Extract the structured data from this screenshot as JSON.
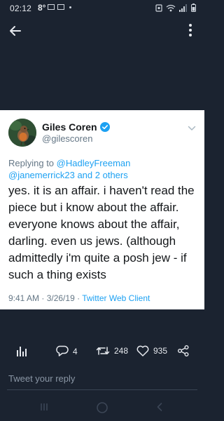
{
  "status_bar": {
    "time": "02:12",
    "temperature": "8°"
  },
  "topbar": {
    "back_icon": "arrow-left-icon",
    "more_icon": "more-vertical-icon"
  },
  "tweet": {
    "display_name": "Giles Coren",
    "handle": "@gilescoren",
    "verified": true,
    "reply_prefix": "Replying to",
    "reply_mentions": "@HadleyFreeman @janemerrick23 and 2 others",
    "text": "yes. it is an affair. i haven't read the piece but i know about the affair. everyone knows about the affair, darling. even us jews. (although admittedly i'm quite a posh jew - if such a thing exists",
    "time": "9:41 AM",
    "separator1": " · ",
    "date": "3/26/19",
    "separator2": " · ",
    "client": "Twitter Web Client"
  },
  "actions": {
    "replies": "4",
    "retweets": "248",
    "likes": "935"
  },
  "reply_box": {
    "placeholder": "Tweet your reply"
  },
  "colors": {
    "background": "#1b2330",
    "card": "#ffffff",
    "accent": "#1da1f2",
    "muted": "#657786"
  }
}
